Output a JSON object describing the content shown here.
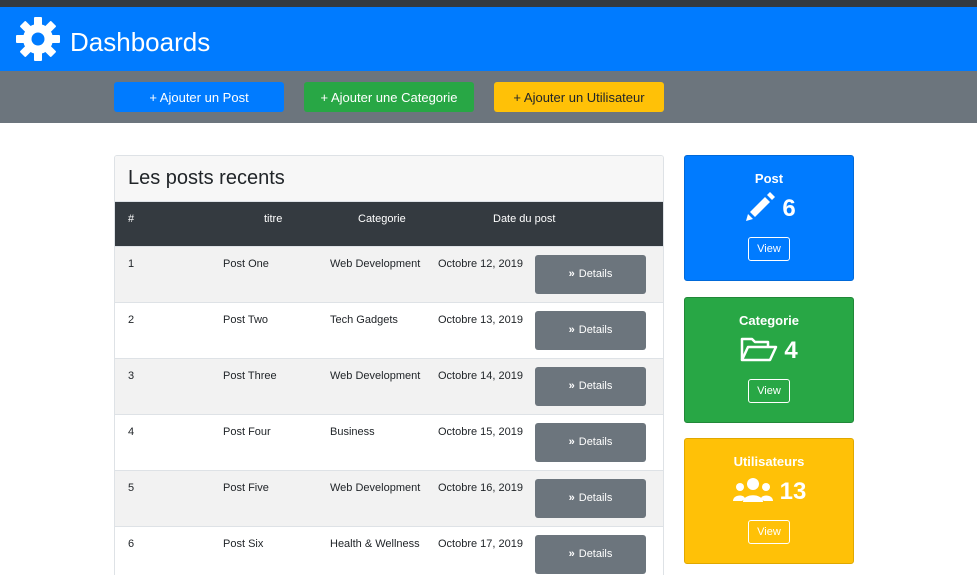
{
  "header": {
    "title": "Dashboards",
    "icon": "gear-icon"
  },
  "actions": {
    "add_post": "+ Ajouter un Post",
    "add_category": "+ Ajouter une Categorie",
    "add_user": "+ Ajouter un Utilisateur"
  },
  "posts": {
    "heading": "Les posts recents",
    "columns": {
      "num": "#",
      "title": "titre",
      "category": "Categorie",
      "date": "Date du post"
    },
    "details_label": "Details",
    "rows": [
      {
        "num": "1",
        "title": "Post One",
        "category": "Web Development",
        "date": "Octobre 12, 2019"
      },
      {
        "num": "2",
        "title": "Post Two",
        "category": "Tech Gadgets",
        "date": "Octobre 13, 2019"
      },
      {
        "num": "3",
        "title": "Post Three",
        "category": "Web Development",
        "date": "Octobre 14, 2019"
      },
      {
        "num": "4",
        "title": "Post Four",
        "category": "Business",
        "date": "Octobre 15, 2019"
      },
      {
        "num": "5",
        "title": "Post Five",
        "category": "Web Development",
        "date": "Octobre 16, 2019"
      },
      {
        "num": "6",
        "title": "Post Six",
        "category": "Health & Wellness",
        "date": "Octobre 17, 2019"
      }
    ]
  },
  "cards": {
    "post": {
      "title": "Post",
      "count": "6",
      "view": "View",
      "icon": "pencil-icon",
      "color": "#007bff"
    },
    "category": {
      "title": "Categorie",
      "count": "4",
      "view": "View",
      "icon": "folder-open-icon",
      "color": "#28a745"
    },
    "users": {
      "title": "Utilisateurs",
      "count": "13",
      "view": "View",
      "icon": "users-icon",
      "color": "#ffc107"
    }
  },
  "colors": {
    "primary": "#007bff",
    "success": "#28a745",
    "warning": "#ffc107",
    "secondary": "#6c757d",
    "dark": "#343a40"
  }
}
